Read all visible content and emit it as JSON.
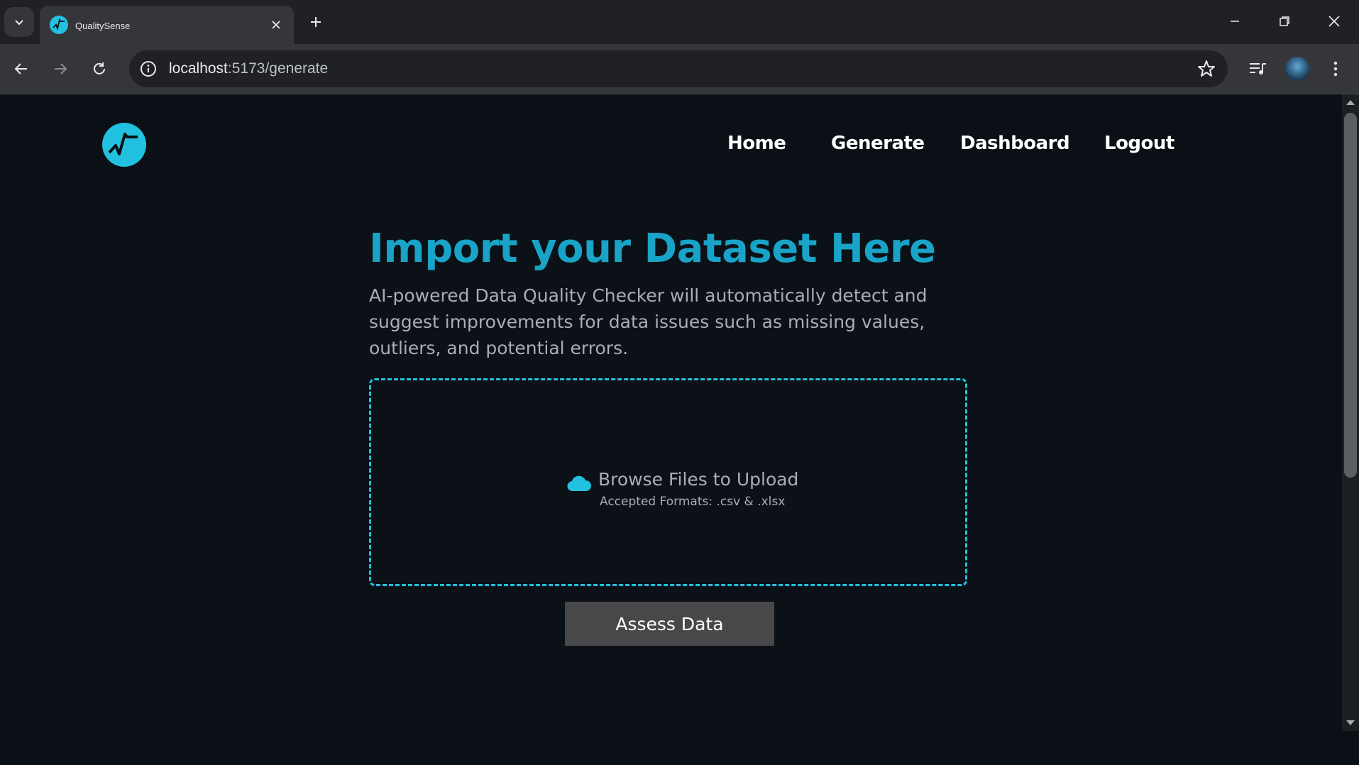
{
  "browser": {
    "tab_title": "QualitySense",
    "url_host": "localhost",
    "url_path": ":5173/generate"
  },
  "nav": {
    "home": "Home",
    "generate": "Generate",
    "dashboard": "Dashboard",
    "logout": "Logout"
  },
  "hero": {
    "title": "Import your Dataset Here",
    "description": "AI-powered Data Quality Checker will automatically detect and suggest improvements for data issues such as missing values, outliers, and potential errors."
  },
  "upload": {
    "browse_label": "Browse Files to Upload",
    "formats_label": "Accepted Formats: .csv & .xlsx"
  },
  "actions": {
    "assess_label": "Assess Data"
  },
  "colors": {
    "accent": "#1aa3c8",
    "dropzone_border": "#22c1df",
    "background": "#0a1015",
    "button_bg": "#48484a"
  }
}
